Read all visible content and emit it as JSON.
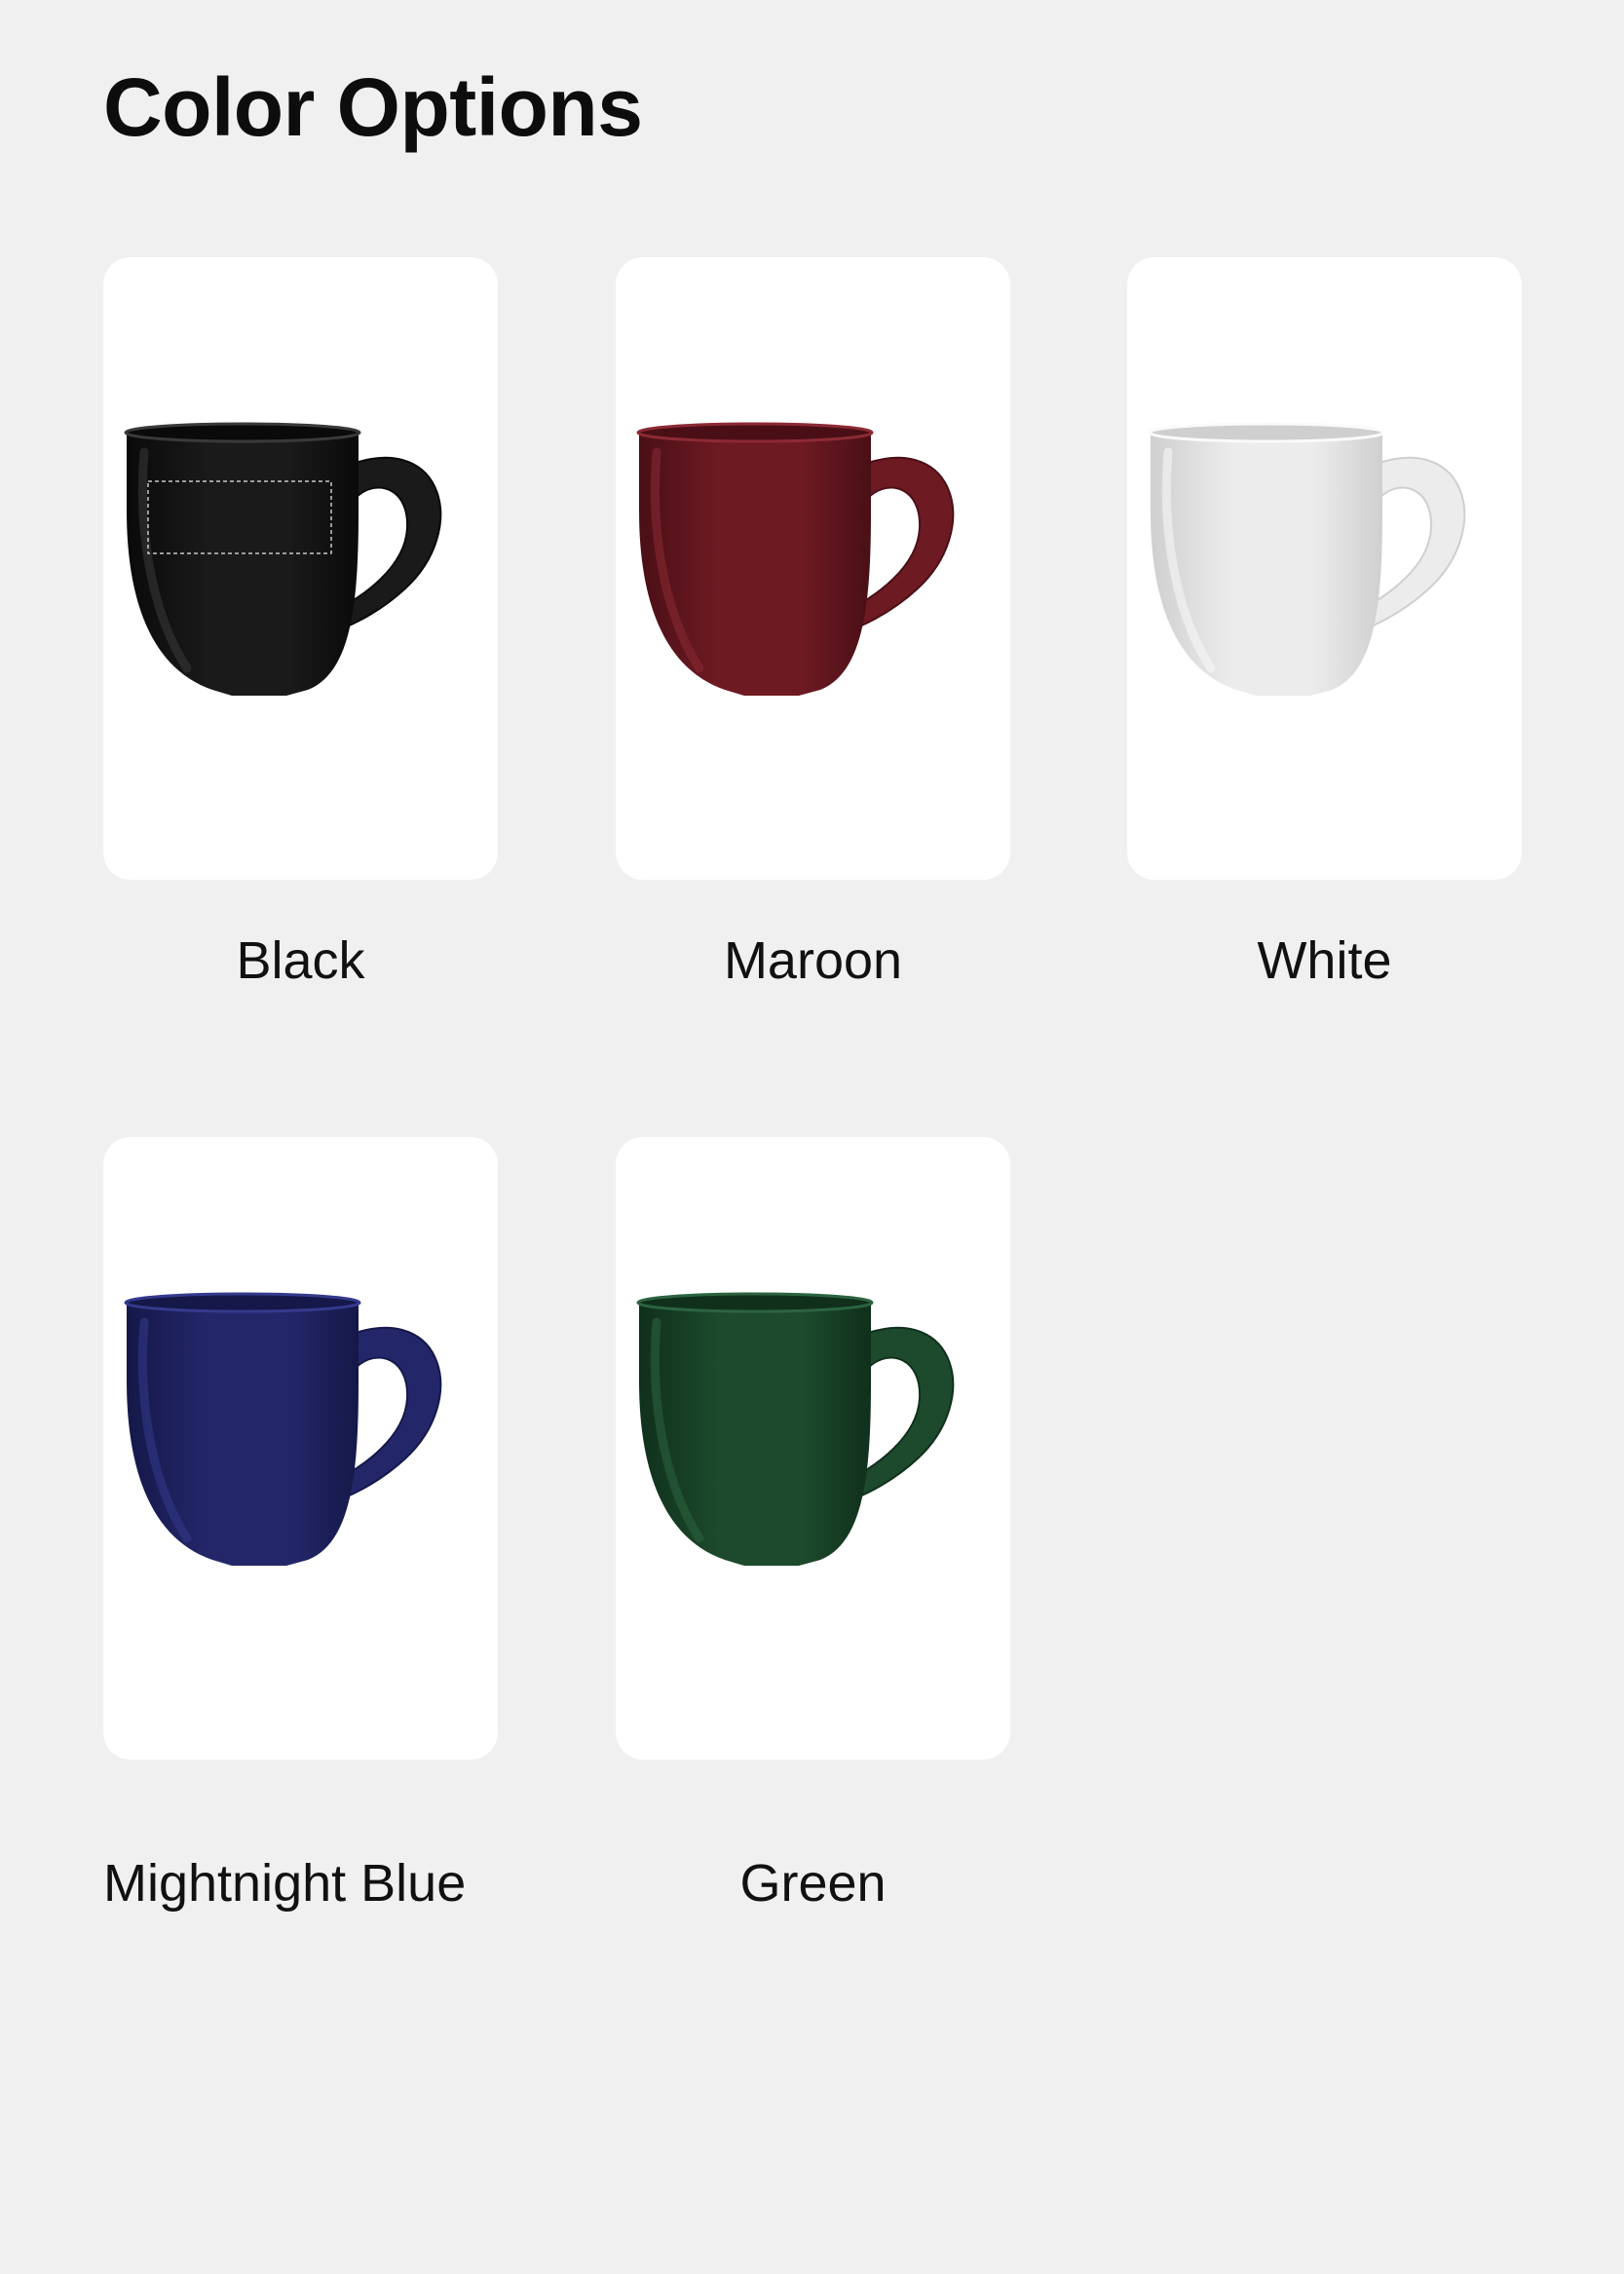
{
  "page": {
    "title": "Color Options"
  },
  "options": [
    {
      "label": "Black",
      "color": "#1a1a1a",
      "highlight": "#3a3a3a",
      "shadow": "#0a0a0a",
      "icon": "mug-icon",
      "print_area": true
    },
    {
      "label": "Maroon",
      "color": "#6e1a23",
      "highlight": "#8c2a34",
      "shadow": "#4a0f16",
      "icon": "mug-icon",
      "print_area": false
    },
    {
      "label": "White",
      "color": "#ececec",
      "highlight": "#fafafa",
      "shadow": "#cfcfcf",
      "icon": "mug-icon",
      "print_area": false
    },
    {
      "label": "Mightnight Blue",
      "color": "#23276a",
      "highlight": "#343a8c",
      "shadow": "#151848",
      "icon": "mug-icon",
      "print_area": false
    },
    {
      "label": "Green",
      "color": "#1d4a2c",
      "highlight": "#2c6440",
      "shadow": "#10301c",
      "icon": "mug-icon",
      "print_area": false
    }
  ],
  "colors": {
    "background": "#f0f0f0",
    "card": "#ffffff",
    "text": "#111111"
  }
}
